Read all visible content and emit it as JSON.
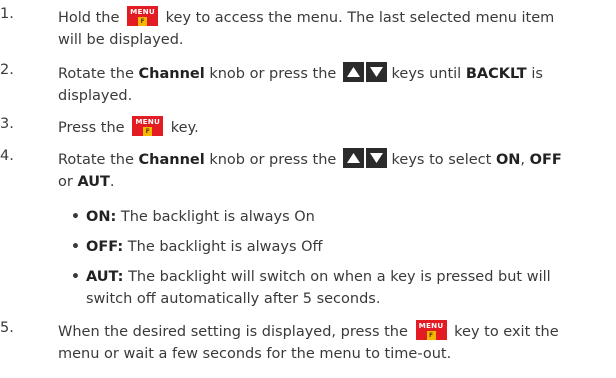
{
  "steps": [
    {
      "num": "1.",
      "a": "Hold the",
      "b": "key to access the menu. The last selected menu item",
      "c": "will be displayed."
    },
    {
      "num": "2.",
      "a": "Rotate the",
      "bold1": "Channel",
      "b": "knob or press the",
      "c": "keys until",
      "bold2": "BACKLT",
      "d": "is",
      "e": "displayed."
    },
    {
      "num": "3.",
      "a": "Press the",
      "b": "key."
    },
    {
      "num": "4.",
      "a": "Rotate the",
      "bold1": "Channel",
      "b": "knob or press the",
      "c": "keys to select",
      "bold2": "ON",
      "d": ",",
      "bold3": "OFF",
      "e": "or",
      "bold4": "AUT",
      "f": "."
    },
    {
      "num": "5.",
      "a": "When the desired setting is displayed, press the",
      "b": "key to exit the",
      "c": "menu or wait a few seconds for the menu to time-out."
    }
  ],
  "bullets": [
    {
      "label": "ON:",
      "text": "The backlight is always On"
    },
    {
      "label": "OFF:",
      "text": "The backlight is always Off"
    },
    {
      "label": "AUT:",
      "text": "The backlight will switch on when a key is pressed but will",
      "text2": "switch off automatically after 5 seconds."
    }
  ],
  "bullet_char": "•",
  "menu_key": {
    "label": "MENU",
    "sub": "F"
  },
  "icons": {
    "menu": "menu-key-icon",
    "up": "up-arrow-key-icon",
    "down": "down-arrow-key-icon"
  },
  "colors": {
    "menu_key": "#e31b23",
    "function_badge": "#f5b800",
    "arrow_key": "#2b2b2b"
  }
}
